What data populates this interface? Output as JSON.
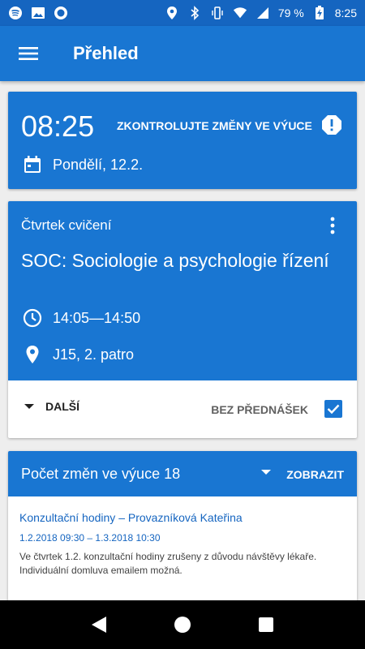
{
  "statusbar": {
    "battery_text": "79 %",
    "time": "8:25",
    "icons_left": [
      "spotify-icon",
      "image-icon",
      "circle-app-icon"
    ],
    "icons_right": [
      "location-icon",
      "bluetooth-icon",
      "vibrate-icon",
      "wifi-icon",
      "signal-icon",
      "battery-charging-icon"
    ]
  },
  "appbar": {
    "title": "Přehled",
    "menu_icon": "hamburger-menu-icon"
  },
  "now_card": {
    "time": "08:25",
    "warning": "ZKONTROLUJTE ZMĚNY VE VÝUCE",
    "date": "Pondělí, 12.2."
  },
  "lesson_card": {
    "type": "Čtvrtek cvičení",
    "title": "SOC: Sociologie a psychologie řízení",
    "time": "14:05—14:50",
    "room": "J15, 2. patro",
    "more_label": "DALŠÍ",
    "no_lectures_label": "BEZ PŘEDNÁŠEK",
    "no_lectures_checked": true
  },
  "changes_card": {
    "title": "Počet změn ve výuce 18",
    "show_label": "ZOBRAZIT",
    "item_title": "Konzultační hodiny – Provazníková Kateřina",
    "item_dates": "1.2.2018 09:30 – 1.3.2018 10:30",
    "item_text": "Ve čtvrtek 1.2. konzultační hodiny zrušeny z důvodu návštěvy lékaře. Individuální domluva emailem možná."
  },
  "colors": {
    "primary": "#1976d2",
    "primary_dark": "#1565c0",
    "background": "#eeeeee"
  }
}
